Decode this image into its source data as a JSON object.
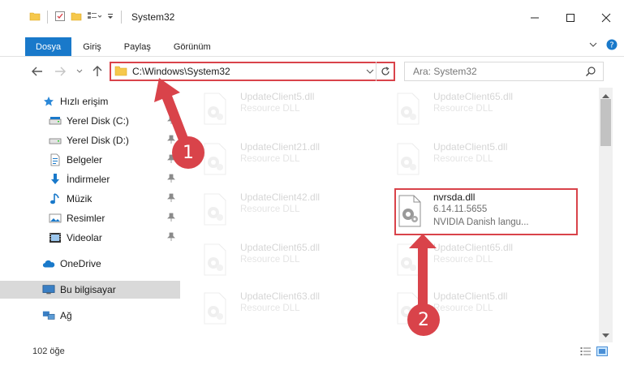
{
  "window": {
    "title": "System32"
  },
  "ribbon": {
    "tabs": [
      "Dosya",
      "Giriş",
      "Paylaş",
      "Görünüm"
    ]
  },
  "address": {
    "path": "C:\\Windows\\System32"
  },
  "search": {
    "placeholder": "Ara: System32"
  },
  "nav": {
    "items": [
      {
        "label": "Hızlı erişim",
        "icon": "star-icon"
      },
      {
        "label": "Yerel Disk (C:)",
        "icon": "drive-icon"
      },
      {
        "label": "Yerel Disk (D:)",
        "icon": "drive-icon"
      },
      {
        "label": "Belgeler",
        "icon": "documents-icon"
      },
      {
        "label": "İndirmeler",
        "icon": "download-icon"
      },
      {
        "label": "Müzik",
        "icon": "music-icon"
      },
      {
        "label": "Resimler",
        "icon": "pictures-icon"
      },
      {
        "label": "Videolar",
        "icon": "videos-icon"
      },
      {
        "label": "OneDrive",
        "icon": "cloud-icon"
      },
      {
        "label": "Bu bilgisayar",
        "icon": "computer-icon"
      },
      {
        "label": "Ağ",
        "icon": "network-icon"
      }
    ]
  },
  "files": [
    {
      "name": "UpdateClient5.dll",
      "desc": "Resource DLL"
    },
    {
      "name": "UpdateClient65.dll",
      "desc": "Resource DLL"
    },
    {
      "name": "UpdateClient21.dll",
      "desc": "Resource DLL"
    },
    {
      "name": "UpdateClient5.dll",
      "desc": "Resource DLL"
    },
    {
      "name": "UpdateClient42.dll",
      "desc": "Resource DLL"
    },
    {
      "name": "nvrsda.dll",
      "version": "6.14.11.5655",
      "desc": "NVIDIA Danish langu..."
    },
    {
      "name": "UpdateClient65.dll",
      "desc": "Resource DLL"
    },
    {
      "name": "UpdateClient65.dll",
      "desc": "Resource DLL"
    },
    {
      "name": "UpdateClient63.dll",
      "desc": "Resource DLL"
    },
    {
      "name": "UpdateClient5.dll",
      "desc": "Resource DLL"
    }
  ],
  "status": {
    "count": "102 öğe"
  },
  "callouts": [
    "1",
    "2"
  ],
  "colors": {
    "accent": "#1979ca",
    "highlight": "#d9434a"
  }
}
